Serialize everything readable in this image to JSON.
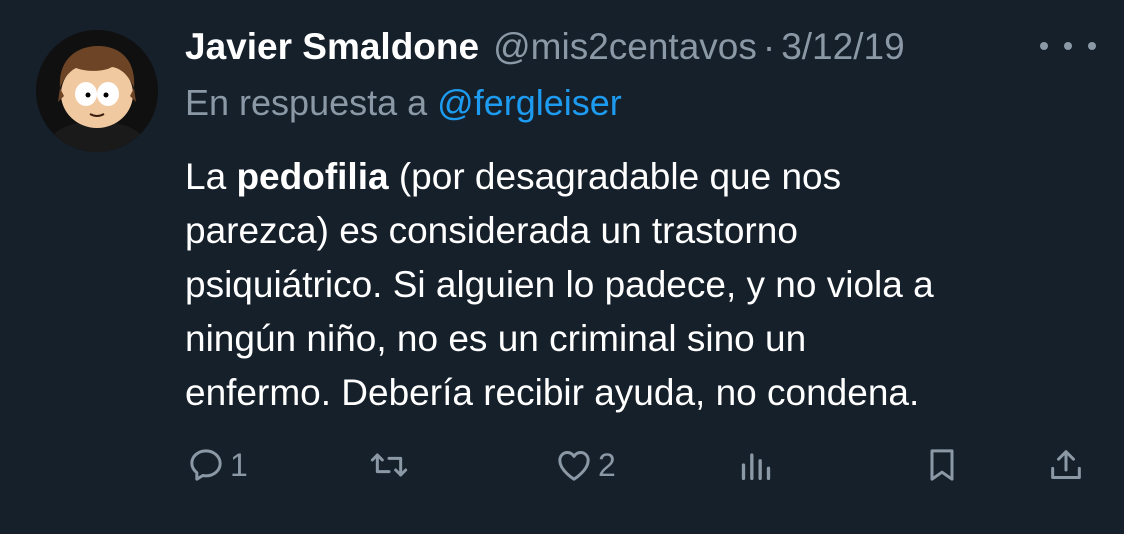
{
  "tweet": {
    "author_name": "Javier Smaldone",
    "author_handle": "@mis2centavos",
    "separator": "·",
    "date": "3/12/19",
    "reply_prefix": "En respuesta a",
    "reply_mention": "@fergleiser",
    "body": {
      "l1_a": "La",
      "l1_bold": "pedofilia",
      "l1_b": "(por desagradable que nos",
      "l2": "parezca) es considerada un trastorno",
      "l3": "psiquiátrico. Si alguien lo padece, y no viola a",
      "l4": "ningún niño, no es un criminal sino un",
      "l5": "enfermo. Debería recibir ayuda, no condena."
    },
    "actions": {
      "reply_count": "1",
      "retweet_count": "",
      "like_count": "2"
    }
  },
  "colors": {
    "background": "#16202b",
    "text_primary": "#ffffff",
    "text_secondary": "#8b98a5",
    "accent": "#1d9bf0"
  },
  "icons": {
    "avatar": "cartoon-avatar",
    "more": "more-horizontal-icon",
    "reply": "reply-bubble-icon",
    "retweet": "retweet-icon",
    "like": "heart-icon",
    "views": "views-bar-chart-icon",
    "bookmark": "bookmark-icon",
    "share": "share-upload-icon"
  }
}
